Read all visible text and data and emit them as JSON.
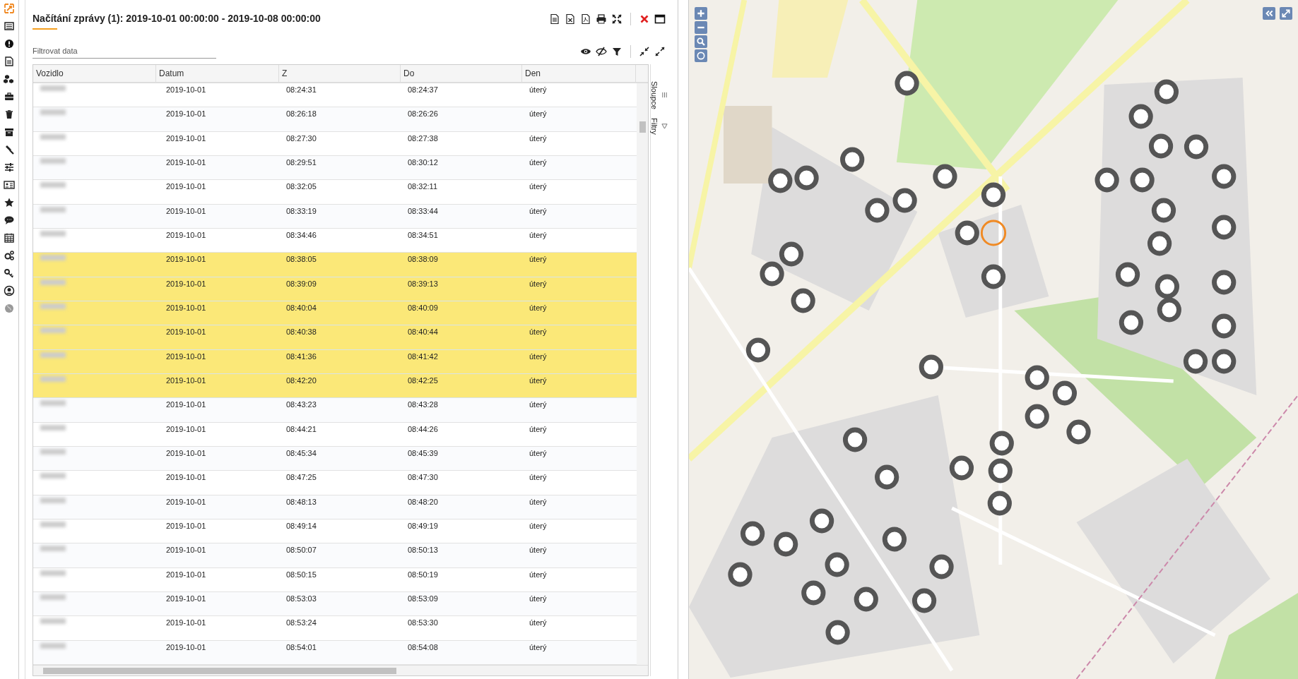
{
  "panel": {
    "title": "Načítání zprávy (1): 2019-10-01 00:00:00 - 2019-10-08 00:00:00",
    "filter": {
      "placeholder": "Filtrovat data"
    }
  },
  "table": {
    "columns": [
      "Vozidlo",
      "Datum",
      "Z",
      "Do",
      "Den"
    ],
    "rows": [
      {
        "date": "2019-10-01",
        "from": "08:24:31",
        "to": "08:24:37",
        "day": "úterý",
        "selected": false
      },
      {
        "date": "2019-10-01",
        "from": "08:26:18",
        "to": "08:26:26",
        "day": "úterý",
        "selected": false
      },
      {
        "date": "2019-10-01",
        "from": "08:27:30",
        "to": "08:27:38",
        "day": "úterý",
        "selected": false
      },
      {
        "date": "2019-10-01",
        "from": "08:29:51",
        "to": "08:30:12",
        "day": "úterý",
        "selected": false
      },
      {
        "date": "2019-10-01",
        "from": "08:32:05",
        "to": "08:32:11",
        "day": "úterý",
        "selected": false
      },
      {
        "date": "2019-10-01",
        "from": "08:33:19",
        "to": "08:33:44",
        "day": "úterý",
        "selected": false
      },
      {
        "date": "2019-10-01",
        "from": "08:34:46",
        "to": "08:34:51",
        "day": "úterý",
        "selected": false
      },
      {
        "date": "2019-10-01",
        "from": "08:38:05",
        "to": "08:38:09",
        "day": "úterý",
        "selected": true
      },
      {
        "date": "2019-10-01",
        "from": "08:39:09",
        "to": "08:39:13",
        "day": "úterý",
        "selected": true
      },
      {
        "date": "2019-10-01",
        "from": "08:40:04",
        "to": "08:40:09",
        "day": "úterý",
        "selected": true
      },
      {
        "date": "2019-10-01",
        "from": "08:40:38",
        "to": "08:40:44",
        "day": "úterý",
        "selected": true
      },
      {
        "date": "2019-10-01",
        "from": "08:41:36",
        "to": "08:41:42",
        "day": "úterý",
        "selected": true
      },
      {
        "date": "2019-10-01",
        "from": "08:42:20",
        "to": "08:42:25",
        "day": "úterý",
        "selected": true
      },
      {
        "date": "2019-10-01",
        "from": "08:43:23",
        "to": "08:43:28",
        "day": "úterý",
        "selected": false
      },
      {
        "date": "2019-10-01",
        "from": "08:44:21",
        "to": "08:44:26",
        "day": "úterý",
        "selected": false
      },
      {
        "date": "2019-10-01",
        "from": "08:45:34",
        "to": "08:45:39",
        "day": "úterý",
        "selected": false
      },
      {
        "date": "2019-10-01",
        "from": "08:47:25",
        "to": "08:47:30",
        "day": "úterý",
        "selected": false
      },
      {
        "date": "2019-10-01",
        "from": "08:48:13",
        "to": "08:48:20",
        "day": "úterý",
        "selected": false
      },
      {
        "date": "2019-10-01",
        "from": "08:49:14",
        "to": "08:49:19",
        "day": "úterý",
        "selected": false
      },
      {
        "date": "2019-10-01",
        "from": "08:50:07",
        "to": "08:50:13",
        "day": "úterý",
        "selected": false
      },
      {
        "date": "2019-10-01",
        "from": "08:50:15",
        "to": "08:50:19",
        "day": "úterý",
        "selected": false
      },
      {
        "date": "2019-10-01",
        "from": "08:53:03",
        "to": "08:53:09",
        "day": "úterý",
        "selected": false
      },
      {
        "date": "2019-10-01",
        "from": "08:53:24",
        "to": "08:53:30",
        "day": "úterý",
        "selected": false
      },
      {
        "date": "2019-10-01",
        "from": "08:54:01",
        "to": "08:54:08",
        "day": "úterý",
        "selected": false
      }
    ]
  },
  "side_tabs": [
    "Sloupce",
    "Filtry"
  ]
}
